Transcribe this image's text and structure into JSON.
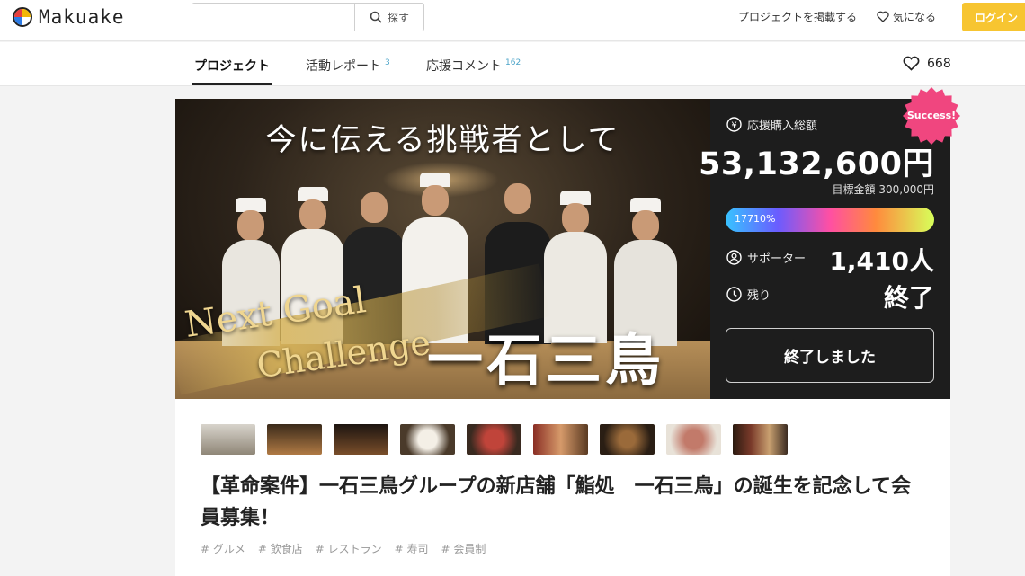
{
  "header": {
    "logo_text": "Makuake",
    "search_placeholder": "",
    "search_button": "探す",
    "post_project": "プロジェクトを掲載する",
    "favorites": "気になる",
    "login": "ログイン"
  },
  "tabs": [
    {
      "label": "プロジェクト",
      "count": ""
    },
    {
      "label": "活動レポート",
      "count": "3"
    },
    {
      "label": "応援コメント",
      "count": "162"
    }
  ],
  "likes_count": "668",
  "hero": {
    "title": "今に伝える挑戦者として",
    "next_goal_line1": "Next Goal",
    "next_goal_line2": "Challenge",
    "brand": "一石三鳥"
  },
  "stats": {
    "success_badge": "Success!",
    "total_label": "応援購入総額",
    "total_amount": "53,132,600円",
    "goal": "目標金額 300,000円",
    "progress_text": "17710%",
    "supporters_label": "サポーター",
    "supporters_value": "1,410人",
    "remaining_label": "残り",
    "remaining_value": "終了",
    "ended_button": "終了しました"
  },
  "project": {
    "title": "【革命案件】一石三鳥グループの新店舗「鮨処　一石三鳥」の誕生を記念して会員募集！",
    "tags": [
      "# グルメ",
      "# 飲食店",
      "# レストラン",
      "# 寿司",
      "# 会員制"
    ]
  },
  "colors": {
    "accent_login": "#f7c531",
    "success_badge": "#f0467f",
    "panel_bg": "#1d1d1d",
    "tab_count": "#4aa3c8"
  }
}
